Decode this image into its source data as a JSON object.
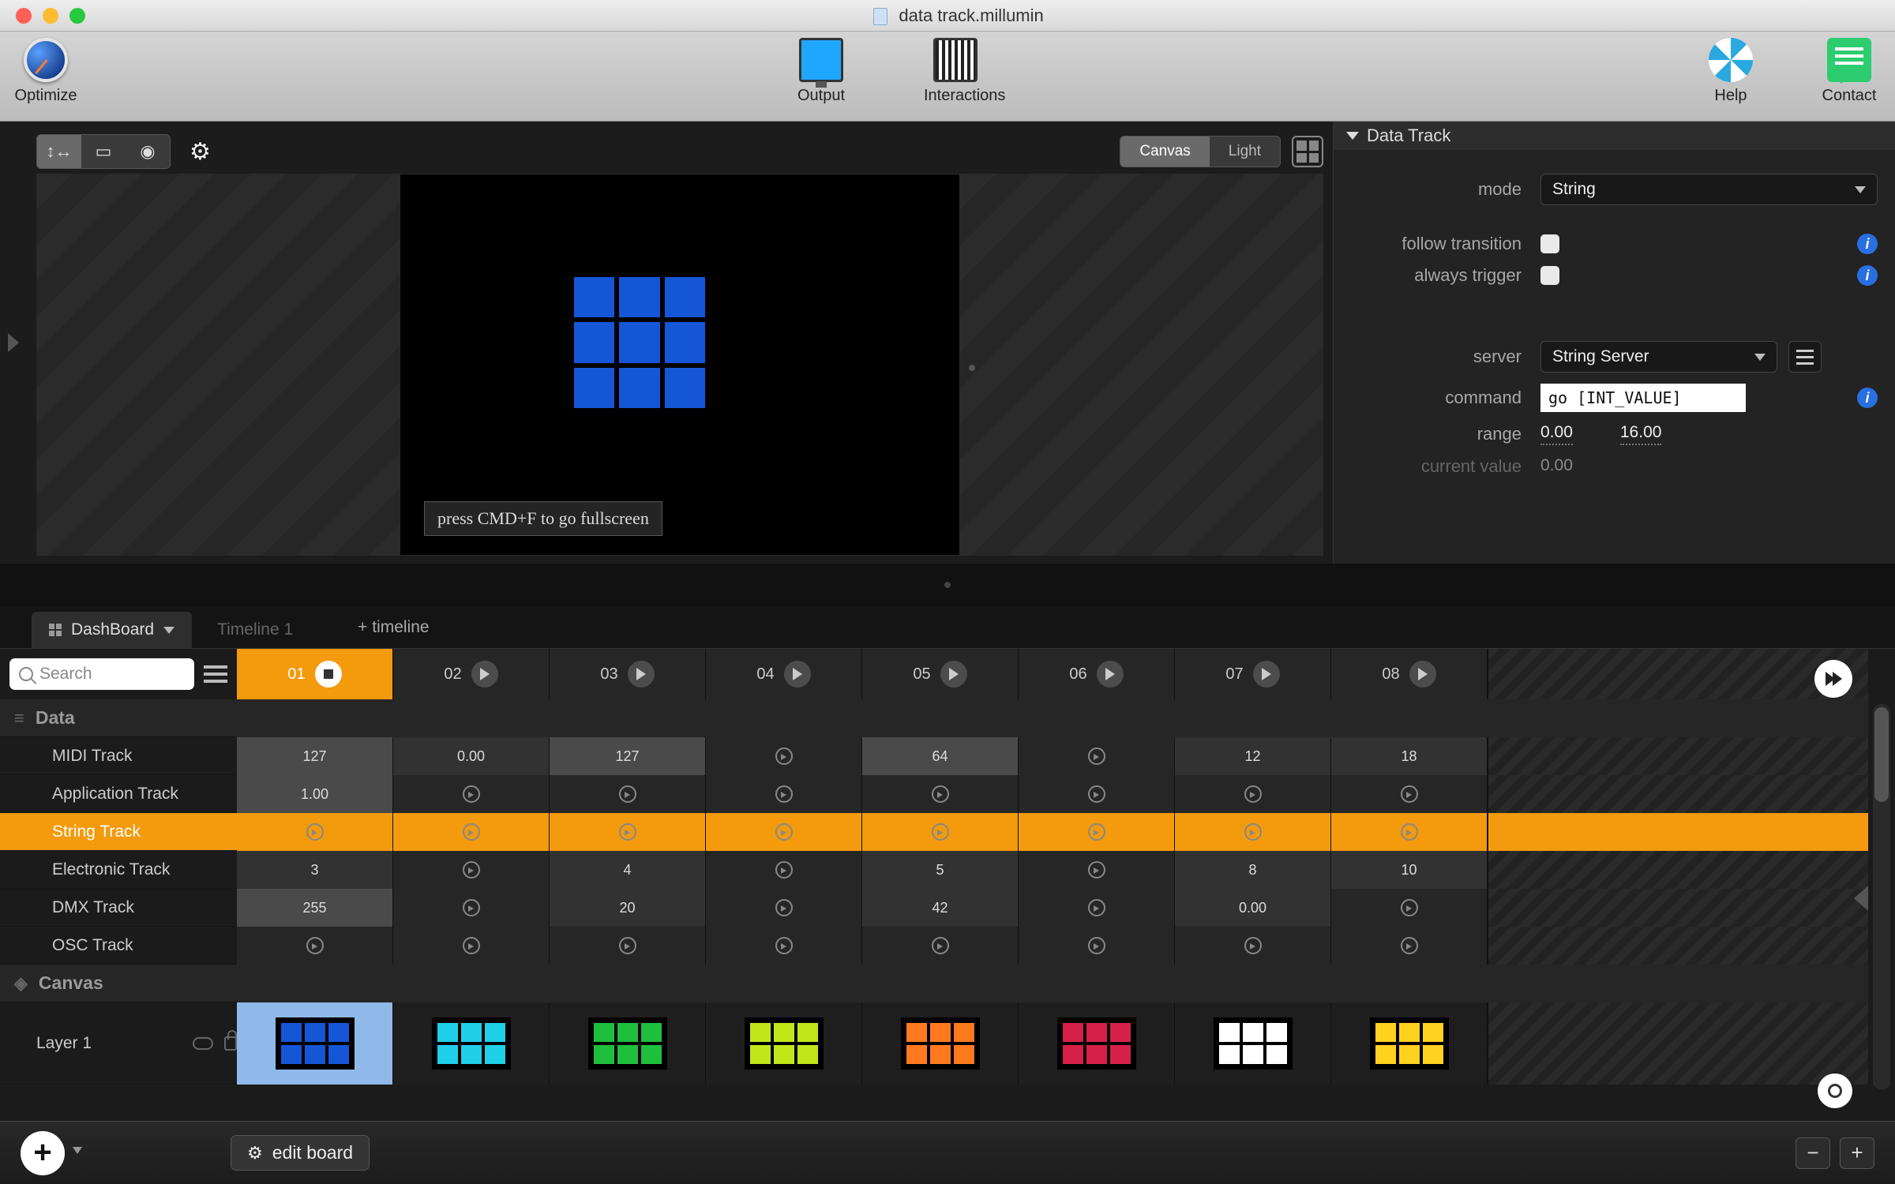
{
  "window": {
    "filename": "data track.millumin"
  },
  "toolbar": {
    "optimize": "Optimize",
    "output": "Output",
    "interactions": "Interactions",
    "help": "Help",
    "contact": "Contact"
  },
  "canvas": {
    "modes": {
      "canvas": "Canvas",
      "light": "Light"
    },
    "hint": "press CMD+F to go fullscreen"
  },
  "inspector": {
    "title": "Data Track",
    "mode_label": "mode",
    "mode_value": "String",
    "follow_transition_label": "follow transition",
    "always_trigger_label": "always trigger",
    "server_label": "server",
    "server_value": "String Server",
    "command_label": "command",
    "command_value": "go [INT_VALUE]",
    "range_label": "range",
    "range_min": "0.00",
    "range_max": "16.00",
    "current_value_label": "current value",
    "current_value": "0.00"
  },
  "tabs": {
    "dashboard": "DashBoard",
    "timeline1": "Timeline 1",
    "add_timeline": "+ timeline"
  },
  "board": {
    "search_placeholder": "Search",
    "columns": [
      "01",
      "02",
      "03",
      "04",
      "05",
      "06",
      "07",
      "08"
    ],
    "section_data": "Data",
    "section_canvas": "Canvas",
    "tracks": {
      "midi": {
        "label": "MIDI Track",
        "cells": [
          "127",
          "0.00",
          "127",
          "",
          "64",
          "",
          "12",
          "18"
        ]
      },
      "application": {
        "label": "Application Track",
        "cells": [
          "1.00",
          "",
          "",
          "",
          "",
          "",
          "",
          ""
        ]
      },
      "string": {
        "label": "String Track",
        "cells": [
          "",
          "",
          "",
          "",
          "",
          "",
          "",
          ""
        ]
      },
      "electronic": {
        "label": "Electronic Track",
        "cells": [
          "3",
          "",
          "4",
          "",
          "5",
          "",
          "8",
          "10"
        ]
      },
      "dmx": {
        "label": "DMX Track",
        "cells": [
          "255",
          "",
          "20",
          "",
          "42",
          "",
          "0.00",
          ""
        ]
      },
      "osc": {
        "label": "OSC Track",
        "cells": [
          "",
          "",
          "",
          "",
          "",
          "",
          "",
          ""
        ]
      }
    },
    "layer1": "Layer 1",
    "thumb_colors": [
      "#1556d6",
      "#1fd0e8",
      "#1fbf3d",
      "#c3e61a",
      "#ff7a1f",
      "#d62048",
      "#ffffff",
      "#ffd21f"
    ]
  },
  "bottombar": {
    "edit_board": "edit board"
  }
}
